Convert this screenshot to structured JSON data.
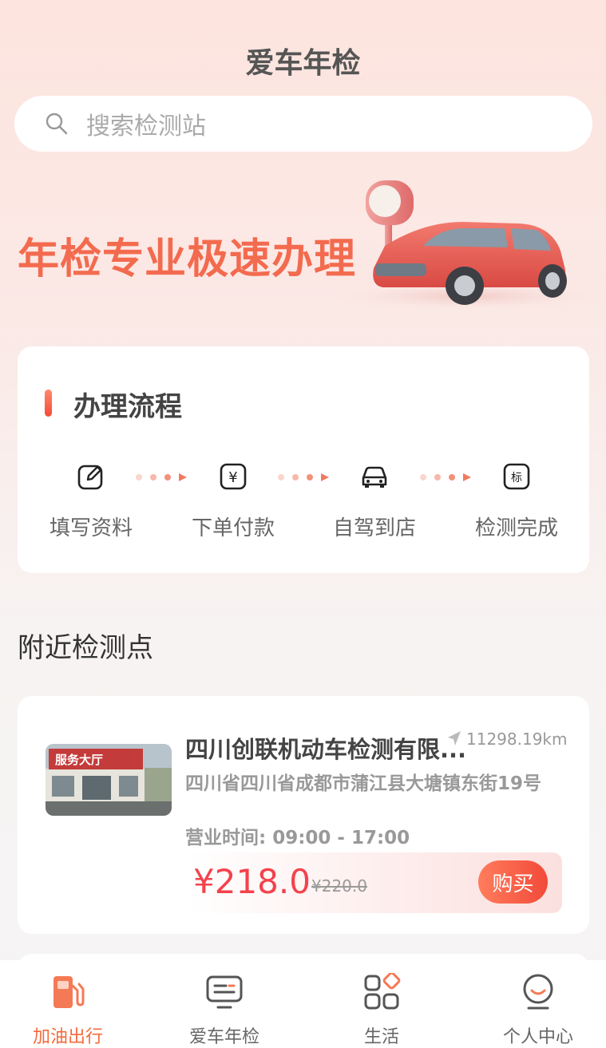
{
  "header": {
    "title": "爱车年检"
  },
  "search": {
    "placeholder": "搜索检测站"
  },
  "hero": {
    "slogan": "年检专业极速办理"
  },
  "process": {
    "title": "办理流程",
    "steps": [
      {
        "label": "填写资料",
        "icon": "edit-icon"
      },
      {
        "label": "下单付款",
        "icon": "yen-icon"
      },
      {
        "label": "自驾到店",
        "icon": "car-icon"
      },
      {
        "label": "检测完成",
        "icon": "badge-icon"
      }
    ],
    "step3_glyph": "标",
    "step2_glyph": "¥"
  },
  "nearby": {
    "title": "附近检测点",
    "stations": [
      {
        "name": "四川创联机动车检测有限...",
        "distance": "11298.19km",
        "address": "四川省四川省成都市蒲江县大塘镇东街19号",
        "hours": "营业时间: 09:00 - 17:00",
        "price": "¥218.0",
        "original_price": "¥220.0",
        "buy_label": "购买",
        "photo_sign": "服务大厅"
      }
    ]
  },
  "tabbar": {
    "items": [
      {
        "label": "加油出行",
        "icon": "fuel-icon",
        "active": true
      },
      {
        "label": "爱车年检",
        "icon": "monitor-icon",
        "active": false
      },
      {
        "label": "生活",
        "icon": "grid-icon",
        "active": false
      },
      {
        "label": "个人中心",
        "icon": "smile-icon",
        "active": false
      }
    ]
  },
  "colors": {
    "accent": "#f36b4f",
    "price": "#f4424c"
  }
}
